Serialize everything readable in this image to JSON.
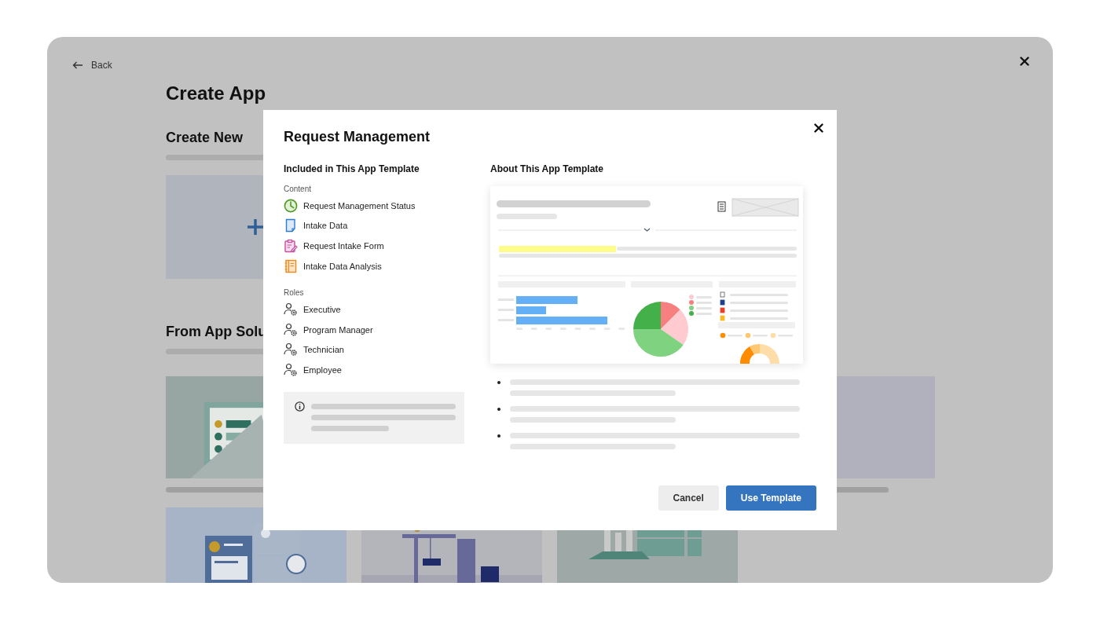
{
  "back_link": {
    "label": "Back"
  },
  "page_title": "Create App",
  "sections": [
    {
      "heading": "Create New",
      "kind": "create"
    },
    {
      "heading": "From App Solu",
      "kind": "gallery"
    }
  ],
  "modal": {
    "title": "Request Management",
    "included": {
      "heading": "Included in This App Template",
      "groups": [
        {
          "label": "Content",
          "items": [
            {
              "label": "Request Management Status",
              "kind": "dashboard"
            },
            {
              "label": "Intake Data",
              "kind": "data"
            },
            {
              "label": "Request Intake Form",
              "kind": "form"
            },
            {
              "label": "Intake Data Analysis",
              "kind": "analysis"
            }
          ]
        },
        {
          "label": "Roles",
          "items": [
            {
              "label": "Executive",
              "kind": "role"
            },
            {
              "label": "Program Manager",
              "kind": "role"
            },
            {
              "label": "Technician",
              "kind": "role"
            },
            {
              "label": "Employee",
              "kind": "role"
            }
          ]
        }
      ]
    },
    "about": {
      "heading": "About This App Template"
    },
    "buttons": [
      {
        "label": "Cancel",
        "kind": "secondary"
      },
      {
        "label": "Use Template",
        "kind": "primary"
      }
    ]
  }
}
